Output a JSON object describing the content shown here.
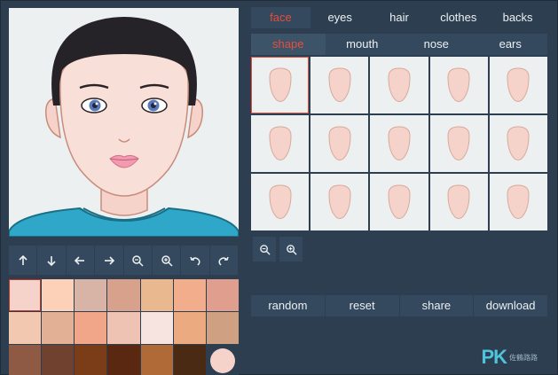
{
  "tabs": [
    "face",
    "eyes",
    "hair",
    "clothes",
    "backs"
  ],
  "active_tab": 0,
  "subtabs": [
    "shape",
    "mouth",
    "nose",
    "ears"
  ],
  "active_subtab": 0,
  "shape_count": 15,
  "selected_shape": 0,
  "actions": {
    "random": "random",
    "reset": "reset",
    "share": "share",
    "download": "download"
  },
  "tool_icons": [
    "arrow-up-icon",
    "arrow-down-icon",
    "arrow-left-icon",
    "arrow-right-icon",
    "zoom-out-icon",
    "zoom-in-icon",
    "undo-icon",
    "redo-icon"
  ],
  "swatch_colors": [
    "#f6d3ca",
    "#fcd1b7",
    "#d8b4a6",
    "#d8a18b",
    "#e9b88f",
    "#f2ad8d",
    "#e09e8e",
    "#f2c9b0",
    "#e2b095",
    "#f1a68a",
    "#eec3b4",
    "#f7e3df",
    "#ecaa80",
    "#cfa082",
    "#8f5a43",
    "#70412e",
    "#7a3d17",
    "#5a2810",
    "#b06a38",
    "#4a2a12",
    "#f6d3ca"
  ],
  "selected_swatch": 0,
  "colors": {
    "background": "#2c3e50",
    "panel": "#34495e",
    "accent": "#e74c3c",
    "text": "#ecf0f1",
    "skin": "#f6d3ca",
    "shirt": "#2ea7c9"
  },
  "watermark": {
    "logo": "PK",
    "text": "佐鶴路路"
  }
}
